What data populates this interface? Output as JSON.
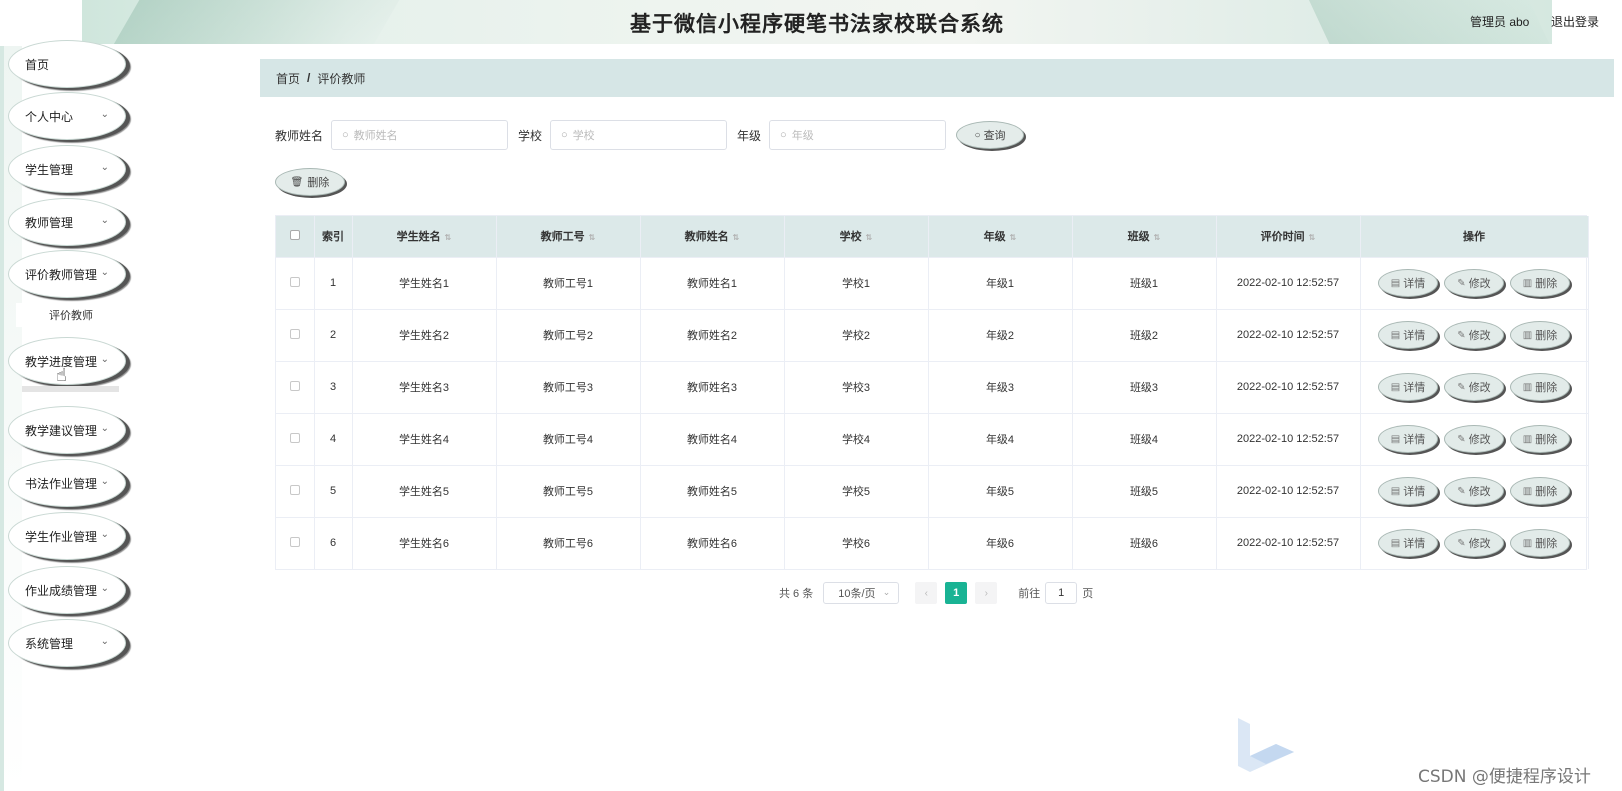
{
  "header": {
    "title": "基于微信小程序硬笔书法家校联合系统",
    "admin": "管理员 abo",
    "logout": "退出登录"
  },
  "sidebar": {
    "items": [
      {
        "label": "首页",
        "chevron": false
      },
      {
        "label": "个人中心",
        "chevron": true
      },
      {
        "label": "学生管理",
        "chevron": true
      },
      {
        "label": "教师管理",
        "chevron": true
      },
      {
        "label": "评价教师管理",
        "chevron": true
      },
      {
        "label": "教学进度管理",
        "chevron": true
      },
      {
        "label": "教学建议管理",
        "chevron": true
      },
      {
        "label": "书法作业管理",
        "chevron": true
      },
      {
        "label": "学生作业管理",
        "chevron": true
      },
      {
        "label": "作业成绩管理",
        "chevron": true
      },
      {
        "label": "系统管理",
        "chevron": true
      }
    ],
    "submenu": {
      "label": "评价教师"
    }
  },
  "breadcrumb": {
    "home": "首页",
    "separator": "/",
    "current": "评价教师"
  },
  "search": {
    "teacher_name_label": "教师姓名",
    "teacher_name_placeholder": "教师姓名",
    "school_label": "学校",
    "school_placeholder": "学校",
    "grade_label": "年级",
    "grade_placeholder": "年级",
    "query_button": "查询"
  },
  "actions": {
    "delete_button": "删除"
  },
  "table": {
    "headers": [
      "索引",
      "学生姓名",
      "教师工号",
      "教师姓名",
      "学校",
      "年级",
      "班级",
      "评价时间",
      "操作"
    ],
    "rows": [
      {
        "index": "1",
        "student": "学生姓名1",
        "teacher_no": "教师工号1",
        "teacher_name": "教师姓名1",
        "school": "学校1",
        "grade": "年级1",
        "class": "班级1",
        "time": "2022-02-10 12:52:57"
      },
      {
        "index": "2",
        "student": "学生姓名2",
        "teacher_no": "教师工号2",
        "teacher_name": "教师姓名2",
        "school": "学校2",
        "grade": "年级2",
        "class": "班级2",
        "time": "2022-02-10 12:52:57"
      },
      {
        "index": "3",
        "student": "学生姓名3",
        "teacher_no": "教师工号3",
        "teacher_name": "教师姓名3",
        "school": "学校3",
        "grade": "年级3",
        "class": "班级3",
        "time": "2022-02-10 12:52:57"
      },
      {
        "index": "4",
        "student": "学生姓名4",
        "teacher_no": "教师工号4",
        "teacher_name": "教师姓名4",
        "school": "学校4",
        "grade": "年级4",
        "class": "班级4",
        "time": "2022-02-10 12:52:57"
      },
      {
        "index": "5",
        "student": "学生姓名5",
        "teacher_no": "教师工号5",
        "teacher_name": "教师姓名5",
        "school": "学校5",
        "grade": "年级5",
        "class": "班级5",
        "time": "2022-02-10 12:52:57"
      },
      {
        "index": "6",
        "student": "学生姓名6",
        "teacher_no": "教师工号6",
        "teacher_name": "教师姓名6",
        "school": "学校6",
        "grade": "年级6",
        "class": "班级6",
        "time": "2022-02-10 12:52:57"
      }
    ],
    "row_actions": {
      "detail": "详情",
      "edit": "修改",
      "delete": "删除"
    }
  },
  "pagination": {
    "total": "共 6 条",
    "page_size": "10条/页",
    "current_page": "1",
    "goto_label": "前往",
    "goto_value": "1",
    "page_suffix": "页"
  },
  "watermark": {
    "text": "CSDN @便捷程序设计"
  },
  "colors": {
    "accent": "#19b394",
    "breadcrumb_bg": "#d6e6e6",
    "table_header_bg": "#dce9e9"
  }
}
